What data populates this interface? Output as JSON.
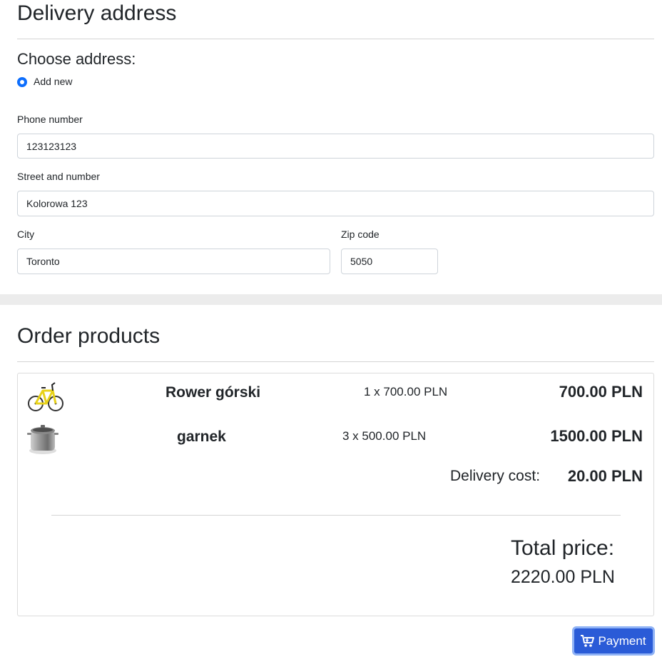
{
  "delivery": {
    "title": "Delivery address",
    "choose_label": "Choose address:",
    "radio_option": "Add new",
    "phone": {
      "label": "Phone number",
      "value": "123123123"
    },
    "street": {
      "label": "Street and number",
      "value": "Kolorowa 123"
    },
    "city": {
      "label": "City",
      "value": "Toronto"
    },
    "zip": {
      "label": "Zip code",
      "value": "5050"
    }
  },
  "order": {
    "title": "Order products",
    "products": [
      {
        "name": "Rower górski",
        "qty": "1 x 700.00 PLN",
        "price": "700.00 PLN",
        "icon": "bicycle-icon"
      },
      {
        "name": "garnek",
        "qty": "3 x 500.00 PLN",
        "price": "1500.00 PLN",
        "icon": "cooking-pot-icon"
      }
    ],
    "delivery_label": "Delivery cost:",
    "delivery_value": "20.00 PLN",
    "total_label": "Total price:",
    "total_value": "2220.00 PLN"
  },
  "payment_button": {
    "label": "Payment",
    "icon": "cart-icon"
  },
  "colors": {
    "primary": "#2a5bd7",
    "radio": "#0d6efd",
    "band": "#ececec"
  }
}
